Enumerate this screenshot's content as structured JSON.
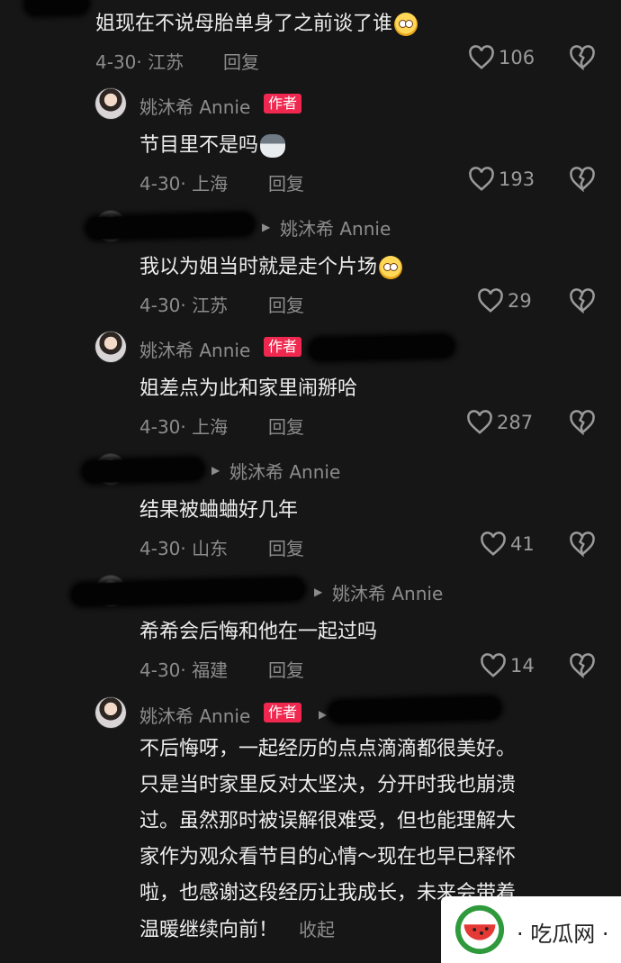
{
  "comments": [
    {
      "text": "姐现在不说母胎单身了之前谈了谁",
      "meta": "4-30· 江苏",
      "reply": "回复",
      "likes": "106"
    },
    {
      "author": "姚沐希 Annie",
      "tag": "作者",
      "text": "节目里不是吗",
      "meta": "4-30· 上海",
      "reply": "回复",
      "likes": "193"
    },
    {
      "reply_to": "姚沐希 Annie",
      "text": "我以为姐当时就是走个片场",
      "meta": "4-30· 江苏",
      "reply": "回复",
      "likes": "29"
    },
    {
      "author": "姚沐希 Annie",
      "tag": "作者",
      "text": "姐差点为此和家里闹掰哈",
      "meta": "4-30· 上海",
      "reply": "回复",
      "likes": "287"
    },
    {
      "reply_to": "姚沐希 Annie",
      "text": "结果被蛐蛐好几年",
      "meta": "4-30· 山东",
      "reply": "回复",
      "likes": "41"
    },
    {
      "reply_to": "姚沐希 Annie",
      "text": "希希会后悔和他在一起过吗",
      "meta": "4-30· 福建",
      "reply": "回复",
      "likes": "14"
    },
    {
      "author": "姚沐希 Annie",
      "tag": "作者",
      "lines": [
        "不后悔呀，一起经历的点点滴滴都很美好。",
        "只是当时家里反对太坚决，分开时我也崩溃",
        "过。虽然那时被误解很难受，但也能理解大",
        "家作为观众看节目的心情～现在也早已释怀",
        "啦，也感谢这段经历让我成长，未来会带着",
        "温暖继续向前！"
      ],
      "collapse": "收起"
    }
  ],
  "watermark": {
    "text": "吃瓜网",
    "dot": "·"
  },
  "colors": {
    "accent": "#f0284f",
    "background": "#161616",
    "muted": "#8c8c8c"
  }
}
